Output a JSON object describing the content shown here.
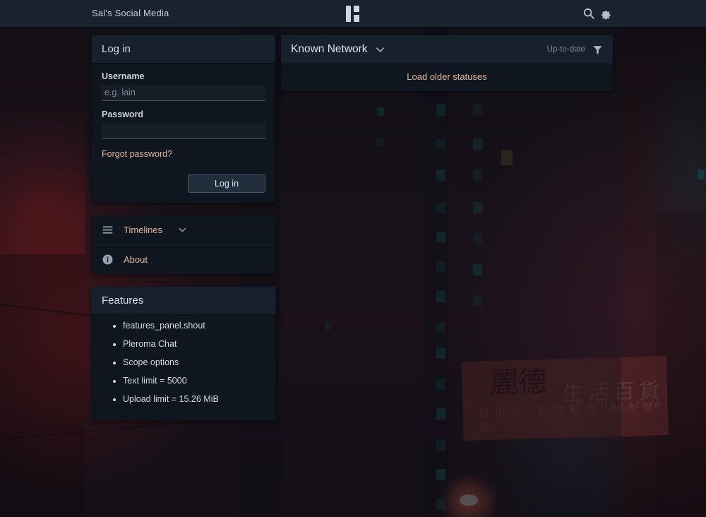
{
  "topbar": {
    "site_name": "Sal's Social Media",
    "logo_name": "pleroma-logo",
    "search_icon": "search-icon",
    "settings_icon": "gear-icon"
  },
  "login_panel": {
    "heading": "Log in",
    "username_label": "Username",
    "username_value": "",
    "username_placeholder": "e.g. lain",
    "password_label": "Password",
    "password_value": "",
    "password_placeholder": "",
    "forgot_link": "Forgot password?",
    "submit_label": "Log in"
  },
  "nav_panel": {
    "items": [
      {
        "label": "Timelines",
        "icon": "hamburger-icon",
        "has_chevron": true
      },
      {
        "label": "About",
        "icon": "info-circle-icon",
        "has_chevron": false
      }
    ]
  },
  "features_panel": {
    "heading": "Features",
    "items": [
      "features_panel.shout",
      "Pleroma Chat",
      "Scope options",
      "Text limit = 5000",
      "Upload limit = 15.26 MiB"
    ]
  },
  "timeline_panel": {
    "title": "Known Network",
    "chevron_icon": "chevron-down-icon",
    "status": "Up-to-date",
    "filter_icon": "filter-funnel-icon",
    "load_older_label": "Load older statuses"
  },
  "background": {
    "sign_main": "麗德",
    "sign_secondary": "生活百貨",
    "sign_english": "LT living store",
    "sign_bottom": "日用品 家庭用品 廚房用品"
  },
  "colors": {
    "accent": "#e4b69b",
    "topbar_bg": "#19232f",
    "panel_header_bg": "#17212d",
    "panel_body_bg": "#0f1620",
    "text_primary": "#d7dee7",
    "text_muted": "#7e8895"
  }
}
